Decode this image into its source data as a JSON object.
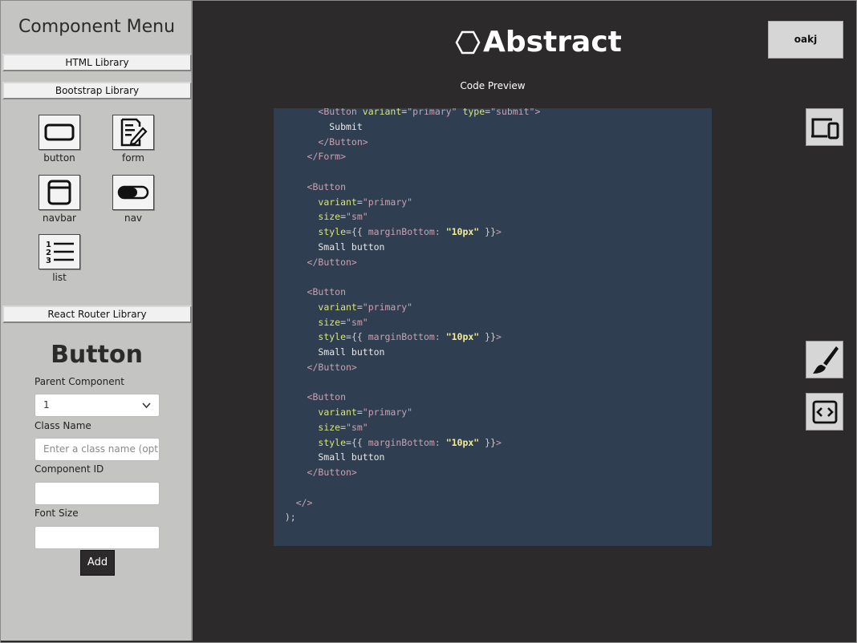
{
  "sidebar": {
    "title": "Component Menu",
    "libraries": {
      "html": "HTML Library",
      "bootstrap": "Bootstrap Library",
      "react_router": "React Router Library"
    },
    "components": [
      {
        "label": "button",
        "icon": "button-icon"
      },
      {
        "label": "form",
        "icon": "form-icon"
      },
      {
        "label": "navbar",
        "icon": "navbar-icon"
      },
      {
        "label": "nav",
        "icon": "nav-toggle-icon"
      },
      {
        "label": "list",
        "icon": "numbered-list-icon"
      }
    ]
  },
  "form": {
    "title": "Button",
    "parent_label": "Parent Component",
    "parent_value": "1",
    "class_label": "Class Name",
    "class_placeholder": "Enter a class name (optic",
    "id_label": "Component ID",
    "font_label": "Font Size",
    "add_label": "Add"
  },
  "header": {
    "logo_text": "Abstract",
    "user": "oakj"
  },
  "preview": {
    "label": "Code Preview"
  },
  "tools": [
    "devices-icon",
    "brush-icon",
    "code-icon"
  ]
}
